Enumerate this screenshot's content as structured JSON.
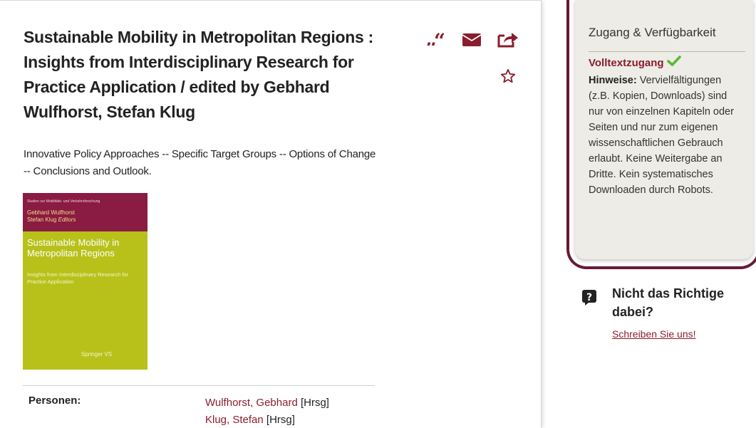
{
  "record": {
    "title": "Sustainable Mobility in Metropolitan Regions : Insights from Interdisciplinary Research for Practice Application / edited by Gebhard Wulfhorst, Stefan Klug",
    "summary": "Innovative Policy Approaches -- Specific Target Groups -- Options of Change -- Conclusions and Outlook."
  },
  "toolbar": {
    "icons": [
      "quote-icon",
      "mail-icon",
      "share-icon",
      "star-icon"
    ],
    "accent": "#8a1d2d"
  },
  "cover": {
    "series": "Studien zur Mobilitäts- und Verkehrsforschung",
    "editor1": "Gebhard Wulfhorst",
    "editor2": "Stefan Klug",
    "editors_suffix": "Editors",
    "title": "Sustainable Mobility in Metropolitan Regions",
    "subtitle": "Insights from Interdisciplinary Research for Practice Application",
    "publisher": "Springer VS",
    "colors": {
      "band": "#8a1b42",
      "body": "#b8c11a"
    }
  },
  "persons": {
    "label": "Personen:",
    "entries": [
      {
        "name": "Wulfhorst, Gebhard",
        "role": "[Hrsg]"
      },
      {
        "name": "Klug, Stefan",
        "role": "[Hrsg]"
      }
    ]
  },
  "access": {
    "heading": "Zugang & Verfügbarkeit",
    "fulltext_label": "Volltextzugang",
    "notes_label": "Hinweise:",
    "notes_text": " Vervielfältigungen (z.B. Kopien, Downloads) sind nur von einzelnen Kapiteln oder Seiten und nur zum eigenen wissenschaftlichen Gebrauch erlaubt. Keine Weitergabe an Dritte. Kein systematisches Downloaden durch Robots.",
    "border_color": "#661a35"
  },
  "help": {
    "title": "Nicht das Richtige dabei?",
    "link": "Schreiben Sie uns!"
  }
}
